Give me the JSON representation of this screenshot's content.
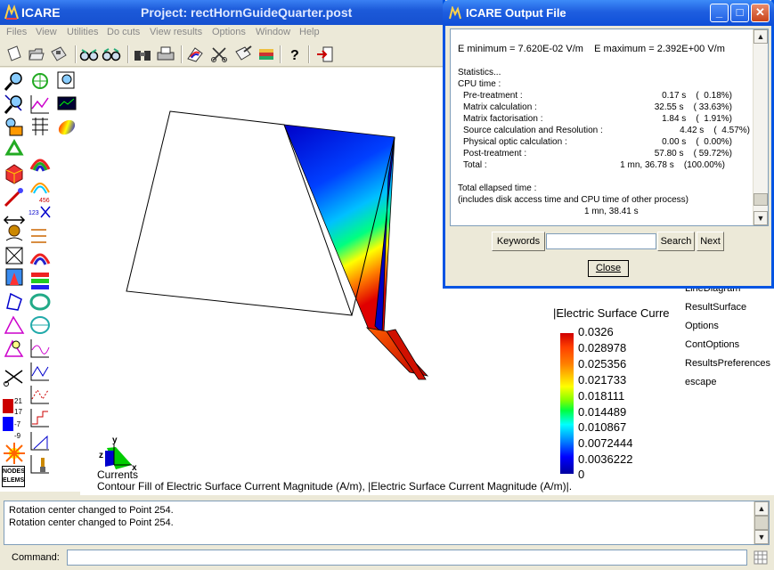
{
  "main_window": {
    "app_name": "ICARE",
    "project_title": "Project: rectHornGuideQuarter.post"
  },
  "menu": [
    "Files",
    "View",
    "Utilities",
    "Do cuts",
    "View results",
    "Options",
    "Window",
    "Help"
  ],
  "toolbar_icons": [
    "new-file-icon",
    "open-folder-icon",
    "save-disk-icon",
    "zoom-in-glasses-icon",
    "zoom-out-glasses-icon",
    "binoculars-icon",
    "print-icon",
    "rainbow-icon",
    "scissors-icon",
    "notebook-icon",
    "books-icon",
    "help-icon",
    "exit-icon"
  ],
  "palette_labels": {
    "scale_values": [
      "21",
      "17",
      "-7",
      "-9"
    ],
    "nodes_elems": "NODES ELEMS",
    "num_456": "456",
    "num_123": "123"
  },
  "right_menu": [
    "LineDiagram",
    "ResultSurface",
    "Options",
    "ContOptions",
    "ResultsPreferences",
    "escape"
  ],
  "legend": {
    "title": "|Electric Surface Curre",
    "values": [
      "0.0326",
      "0.028978",
      "0.025356",
      "0.021733",
      "0.018111",
      "0.014489",
      "0.010867",
      "0.0072444",
      "0.0036222",
      "0"
    ]
  },
  "axes": {
    "y": "y",
    "z": "z",
    "x": "x"
  },
  "captions": {
    "line1": "Currents",
    "line2": "Contour Fill of Electric Surface Current Magnitude (A/m), |Electric Surface Current Magnitude (A/m)|."
  },
  "log": [
    "Rotation center changed to Point 254.",
    "Rotation center changed to Point 254."
  ],
  "command": {
    "label": "Command:",
    "value": ""
  },
  "output_window": {
    "title": "ICARE Output File",
    "lines": [
      "E minimum = 7.620E-02 V/m    E maximum = 2.392E+00 V/m",
      "Statistics...",
      "CPU time :",
      "Pre-treatment :",
      "Matrix calculation :",
      "Matrix factorisation :",
      "Source calculation and Resolution :",
      "Physical optic calculation :",
      "Post-treatment :",
      "Total :",
      "Total ellapsed time :",
      "(includes disk access time and CPU time of other process)",
      "1 mn, 38.41 s"
    ],
    "cpu_values": [
      "0.17 s    (  0.18%)",
      "32.55 s    ( 33.63%)",
      "1.84 s    (  1.91%)",
      "4.42 s    (  4.57%)",
      "0.00 s    (  0.00%)",
      "57.80 s    ( 59.72%)",
      "1 mn, 36.78 s    (100.00%)"
    ],
    "keywords_label": "Keywords",
    "search_label": "Search",
    "next_label": "Next",
    "close_label": "Close"
  }
}
